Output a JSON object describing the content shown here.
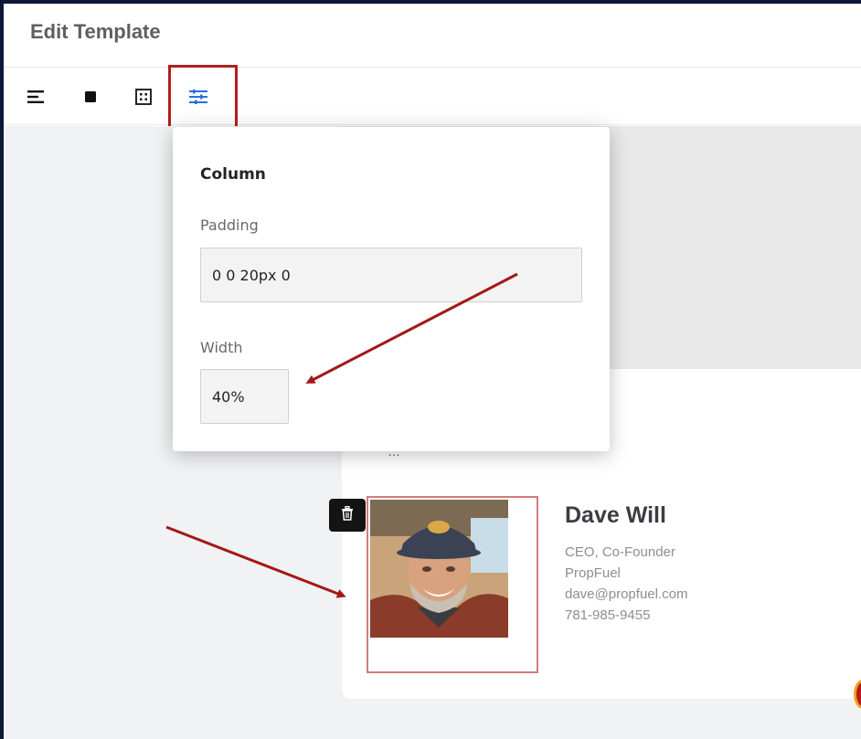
{
  "header": {
    "title": "Edit Template"
  },
  "toolbar": {
    "tools": [
      {
        "name": "align-left-icon",
        "active": false
      },
      {
        "name": "square-icon",
        "active": false
      },
      {
        "name": "grid-icon",
        "active": false
      },
      {
        "name": "sliders-icon",
        "active": true
      }
    ]
  },
  "popover": {
    "title": "Column",
    "padding_label": "Padding",
    "padding_value": "0 0 20px 0",
    "width_label": "Width",
    "width_value": "40%"
  },
  "signature": {
    "name": "Dave Will",
    "role": "CEO, Co-Founder",
    "company": "PropFuel",
    "email": "dave@propfuel.com",
    "phone": "781-985-9455"
  },
  "colors": {
    "accent": "#2a6fe0",
    "annotation": "#a31818",
    "column_outline": "#d47b7b"
  }
}
